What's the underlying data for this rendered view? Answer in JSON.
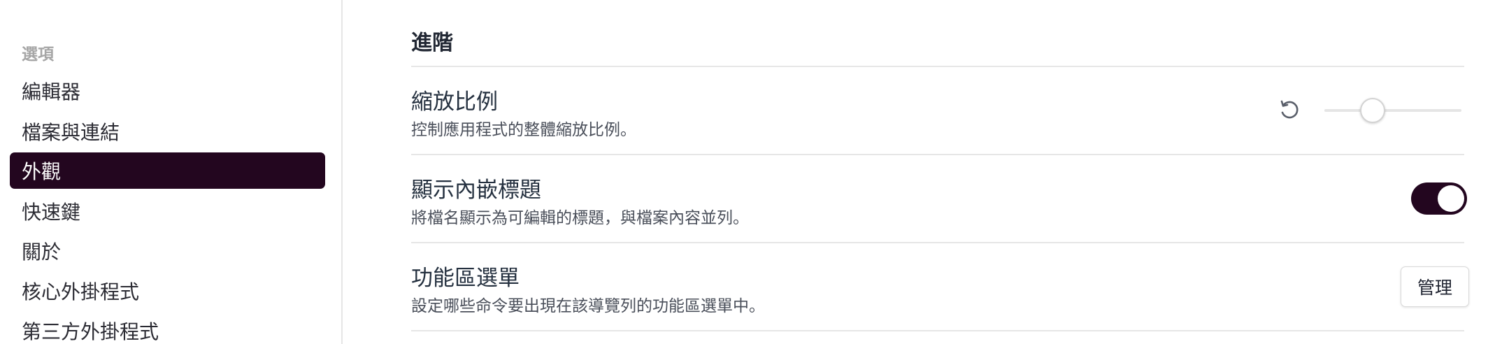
{
  "sidebar": {
    "section_label": "選項",
    "items": [
      {
        "label": "編輯器",
        "active": false
      },
      {
        "label": "檔案與連結",
        "active": false
      },
      {
        "label": "外觀",
        "active": true
      },
      {
        "label": "快速鍵",
        "active": false
      },
      {
        "label": "關於",
        "active": false
      },
      {
        "label": "核心外掛程式",
        "active": false
      },
      {
        "label": "第三方外掛程式",
        "active": false
      }
    ]
  },
  "main": {
    "section_heading": "進階",
    "settings": [
      {
        "name": "縮放比例",
        "description": "控制應用程式的整體縮放比例。",
        "control": "slider",
        "slider_value_fraction": 0.35,
        "reset_icon": "undo-icon"
      },
      {
        "name": "顯示內嵌標題",
        "description": "將檔名顯示為可編輯的標題，與檔案內容並列。",
        "control": "toggle",
        "toggle_on": true
      },
      {
        "name": "功能區選單",
        "description": "設定哪些命令要出現在該導覽列的功能區選單中。",
        "control": "button",
        "button_label": "管理"
      }
    ]
  },
  "colors": {
    "accent": "#23061f",
    "divider": "#e6e6e6",
    "section_label": "#a6a6a6"
  }
}
